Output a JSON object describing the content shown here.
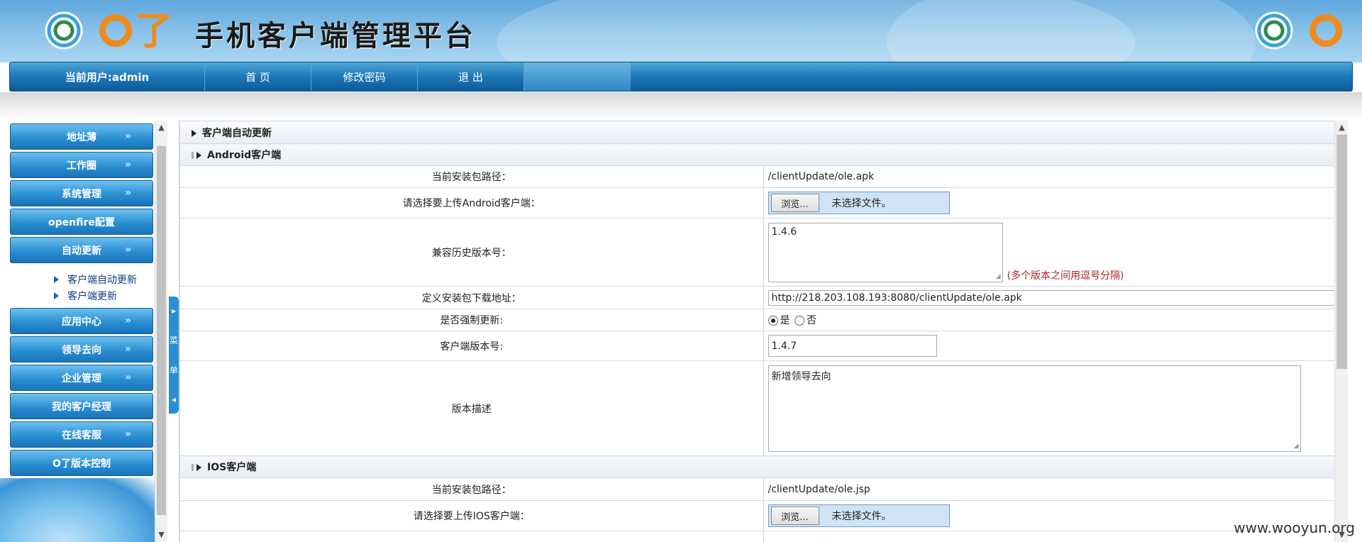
{
  "header": {
    "logo_text": "O了",
    "title": "手机客户端管理平台"
  },
  "nav": {
    "user": "当前用户:admin",
    "items": [
      "首 页",
      "修改密码",
      "退 出"
    ]
  },
  "sidebar": {
    "items": [
      "地址薄",
      "工作圈",
      "系统管理",
      "openfire配置",
      "自动更新",
      "应用中心",
      "领导去向",
      "企业管理",
      "我的客户经理",
      "在线客服",
      "O了版本控制"
    ],
    "arrow": "»",
    "subitems": [
      "客户端自动更新",
      "客户端更新"
    ],
    "toggle_text": [
      "菜",
      "单"
    ]
  },
  "main": {
    "section_title": "客户端自动更新",
    "android": {
      "heading": "Android客户端",
      "path_label": "当前安装包路径：",
      "path_value": "/clientUpdate/ole.apk",
      "upload_label": "请选择要上传Android客户端：",
      "browse_label": "浏览...",
      "no_file": "未选择文件。",
      "compat_label": "兼容历史版本号：",
      "compat_value": "1.4.6",
      "compat_hint": "(多个版本之间用逗号分隔)",
      "url_label": "定义安装包下载地址：",
      "url_value": "http://218.203.108.193:8080/clientUpdate/ole.apk",
      "force_label": "是否强制更新:",
      "force_yes": "是",
      "force_no": "否",
      "version_label": "客户端版本号:",
      "version_value": "1.4.7",
      "desc_label": "版本描述",
      "desc_value": "新增领导去向"
    },
    "ios": {
      "heading": "IOS客户端",
      "path_label": "当前安装包路径：",
      "path_value": "/clientUpdate/ole.jsp",
      "upload_label": "请选择要上传IOS客户端：",
      "browse_label": "浏览...",
      "no_file": "未选择文件。"
    }
  },
  "watermark": "www.wooyun.org",
  "colors": {
    "accent": "#1d77b8",
    "hint": "#b22222",
    "brand_orange": "#f08a1c"
  },
  "icons": [
    "logo-icon",
    "arrow-icon",
    "triangle-bullet-icon",
    "radio-icon",
    "resize-grip-icon"
  ]
}
